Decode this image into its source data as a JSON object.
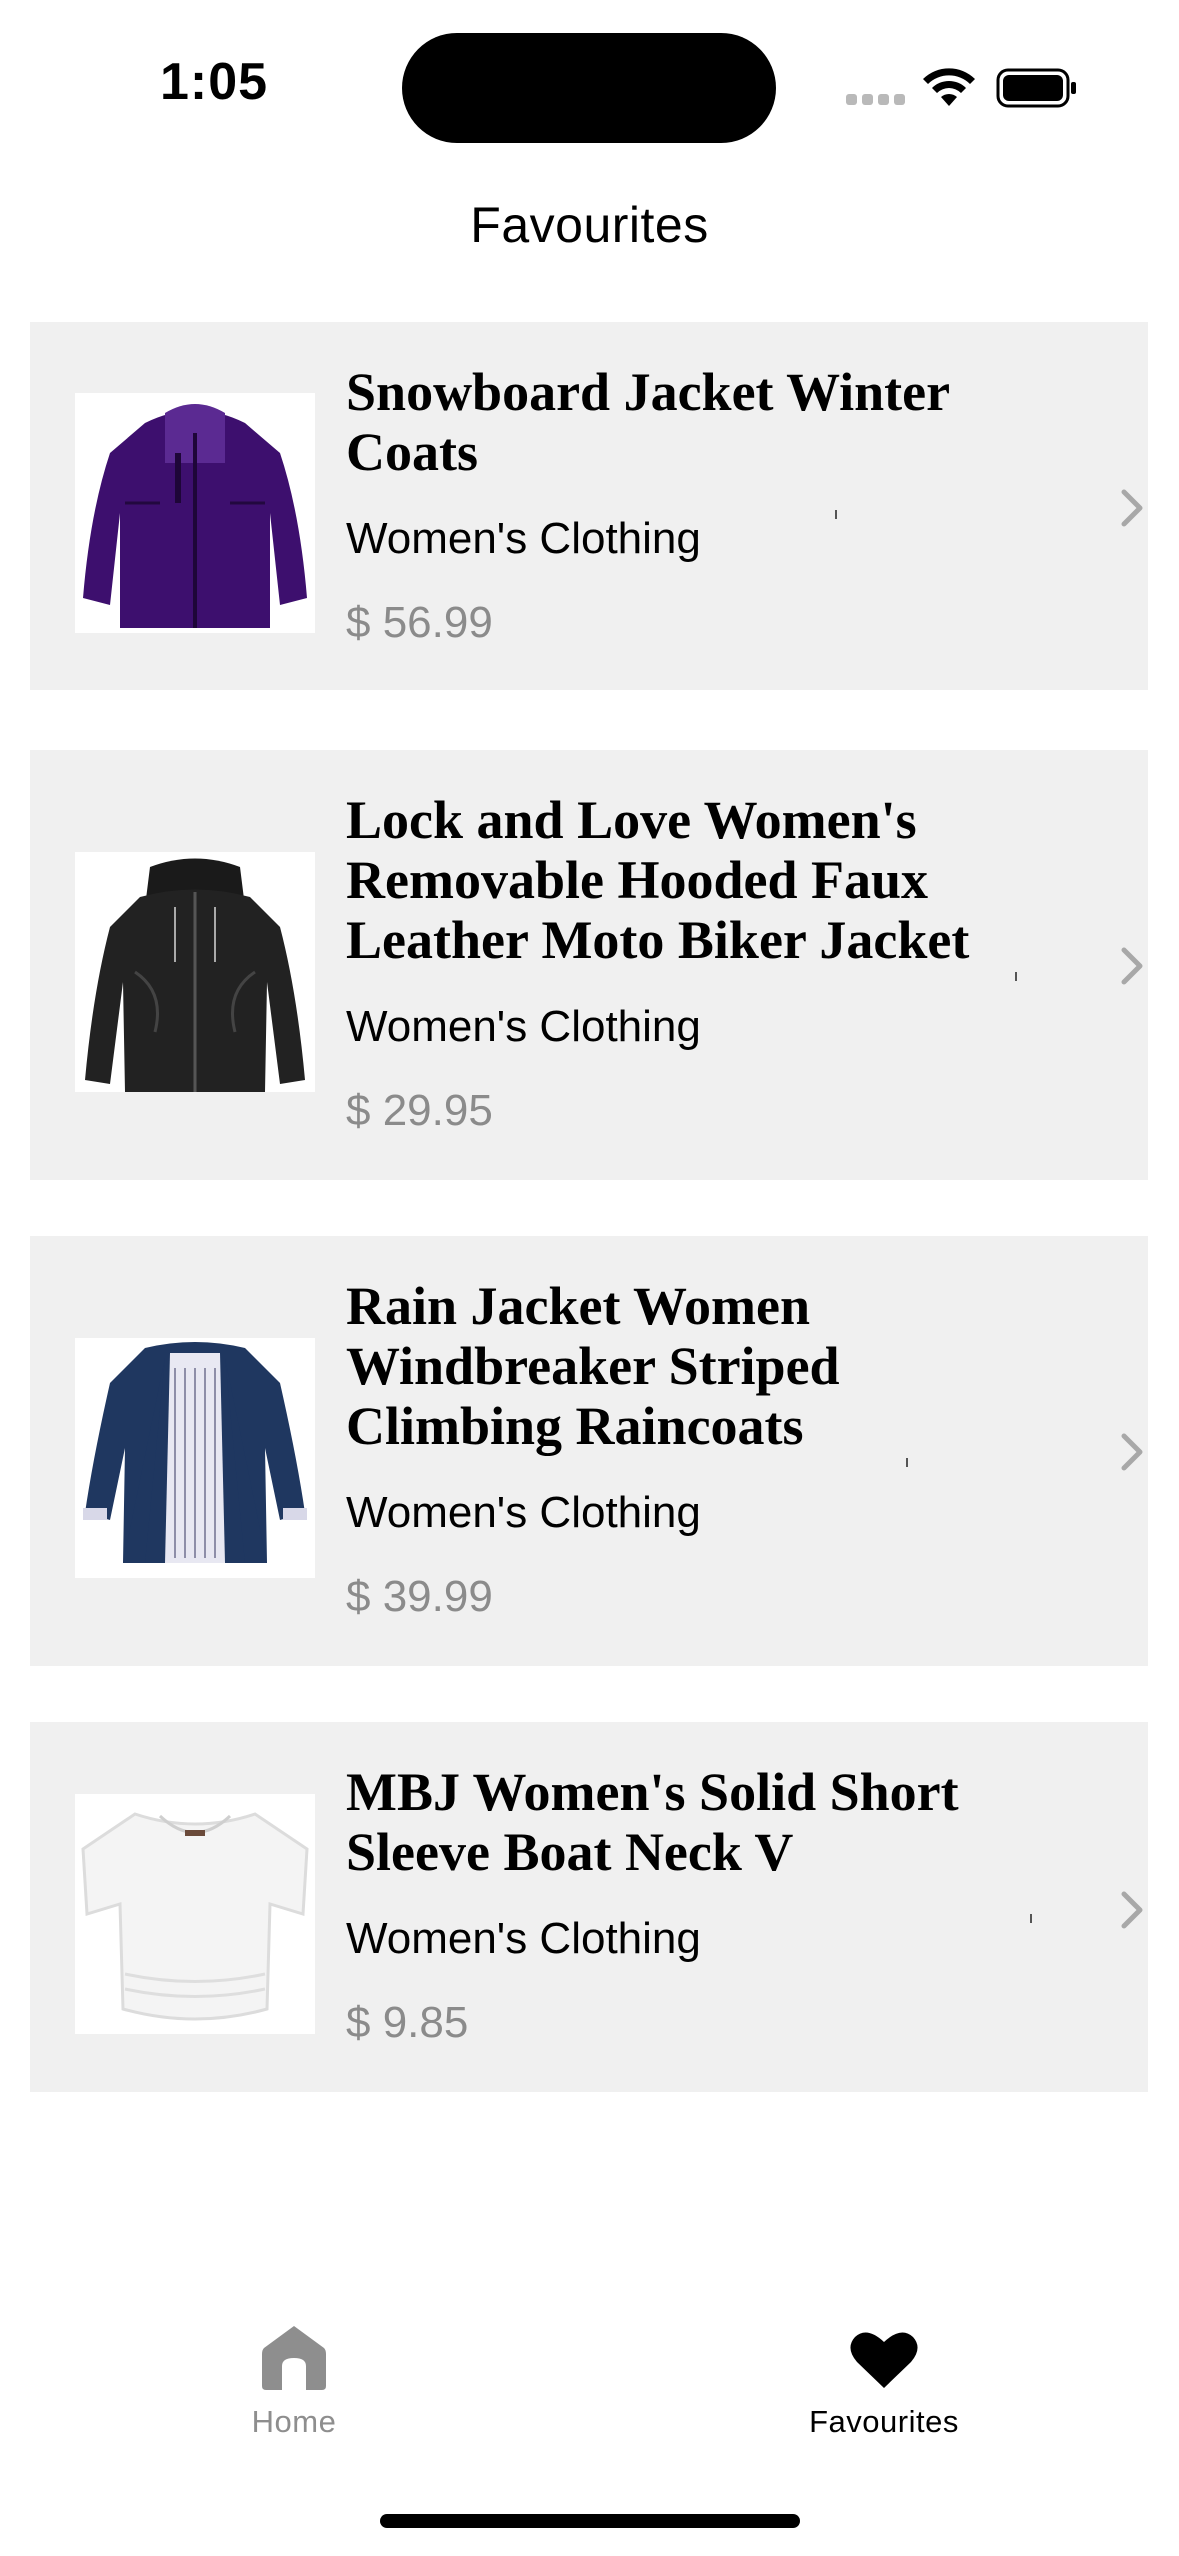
{
  "status_bar": {
    "time": "1:05"
  },
  "header": {
    "title": "Favourites"
  },
  "favourites": [
    {
      "title": "Snowboard Jacket Winter Coats",
      "category": "Women's Clothing",
      "price": "$ 56.99",
      "image": "purple-snowboard-jacket"
    },
    {
      "title": "Lock and Love Women's Removable Hooded Faux Leather Moto Biker Jacket",
      "category": "Women's Clothing",
      "price": "$ 29.95",
      "image": "black-leather-biker-jacket"
    },
    {
      "title": "Rain Jacket Women Windbreaker Striped Climbing Raincoats",
      "category": "Women's Clothing",
      "price": "$ 39.99",
      "image": "navy-rain-jacket"
    },
    {
      "title": "MBJ Women's Solid Short Sleeve Boat Neck V",
      "category": "Women's Clothing",
      "price": "$ 9.85",
      "image": "white-short-sleeve-top"
    }
  ],
  "tab_bar": {
    "tabs": [
      {
        "label": "Home",
        "icon": "home-icon",
        "active": false
      },
      {
        "label": "Favourites",
        "icon": "heart-icon",
        "active": true
      }
    ]
  },
  "colors": {
    "card_background": "#f0f0f0",
    "price": "#8b8b8b",
    "inactive_tab": "#8e8e8e",
    "active_tab": "#000000"
  }
}
